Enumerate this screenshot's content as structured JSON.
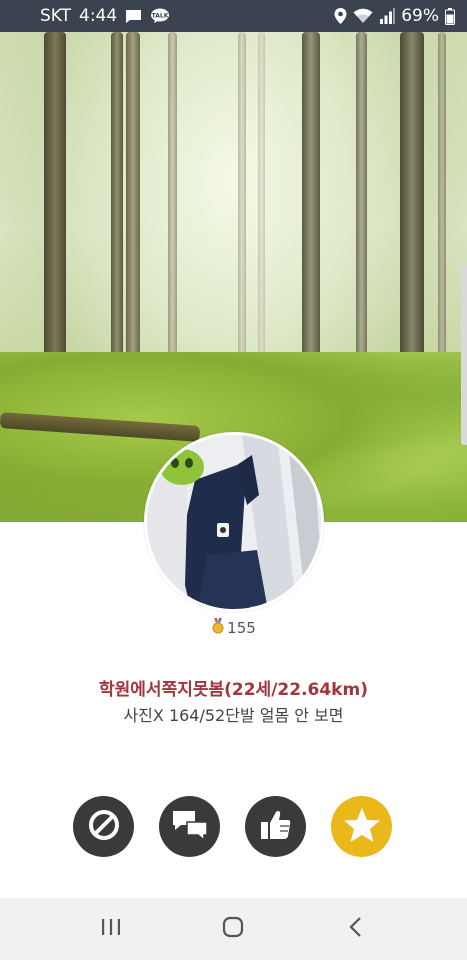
{
  "status_bar": {
    "carrier": "SKT",
    "time": "4:44",
    "battery": "69%",
    "left_icons": [
      "message-icon",
      "kakaotalk-icon"
    ],
    "kakao_label": "TALK",
    "right_icons": [
      "location-icon",
      "wifi-icon",
      "signal-icon",
      "battery-icon"
    ]
  },
  "profile": {
    "medal_icon": "medal-icon",
    "medal_count": "155",
    "name_line": "학원에서쪽지못봄(22세/22.64km)",
    "bio": "사진X 164/52단발 얼몸 안 보면"
  },
  "actions": [
    {
      "icon": "block-icon",
      "color": "#3a3a3a"
    },
    {
      "icon": "chat-bubbles-icon",
      "color": "#3a3a3a"
    },
    {
      "icon": "thumbs-up-icon",
      "color": "#3a3a3a"
    },
    {
      "icon": "star-icon",
      "color": "#eab81b"
    }
  ],
  "nav": [
    "recent-apps-icon",
    "home-icon",
    "back-icon"
  ],
  "colors": {
    "status_bar_bg": "#3c4350",
    "name_color": "#a2353a",
    "star_button": "#eab81b",
    "action_button": "#3a3a3a",
    "nav_bg": "#f1f1f1"
  }
}
